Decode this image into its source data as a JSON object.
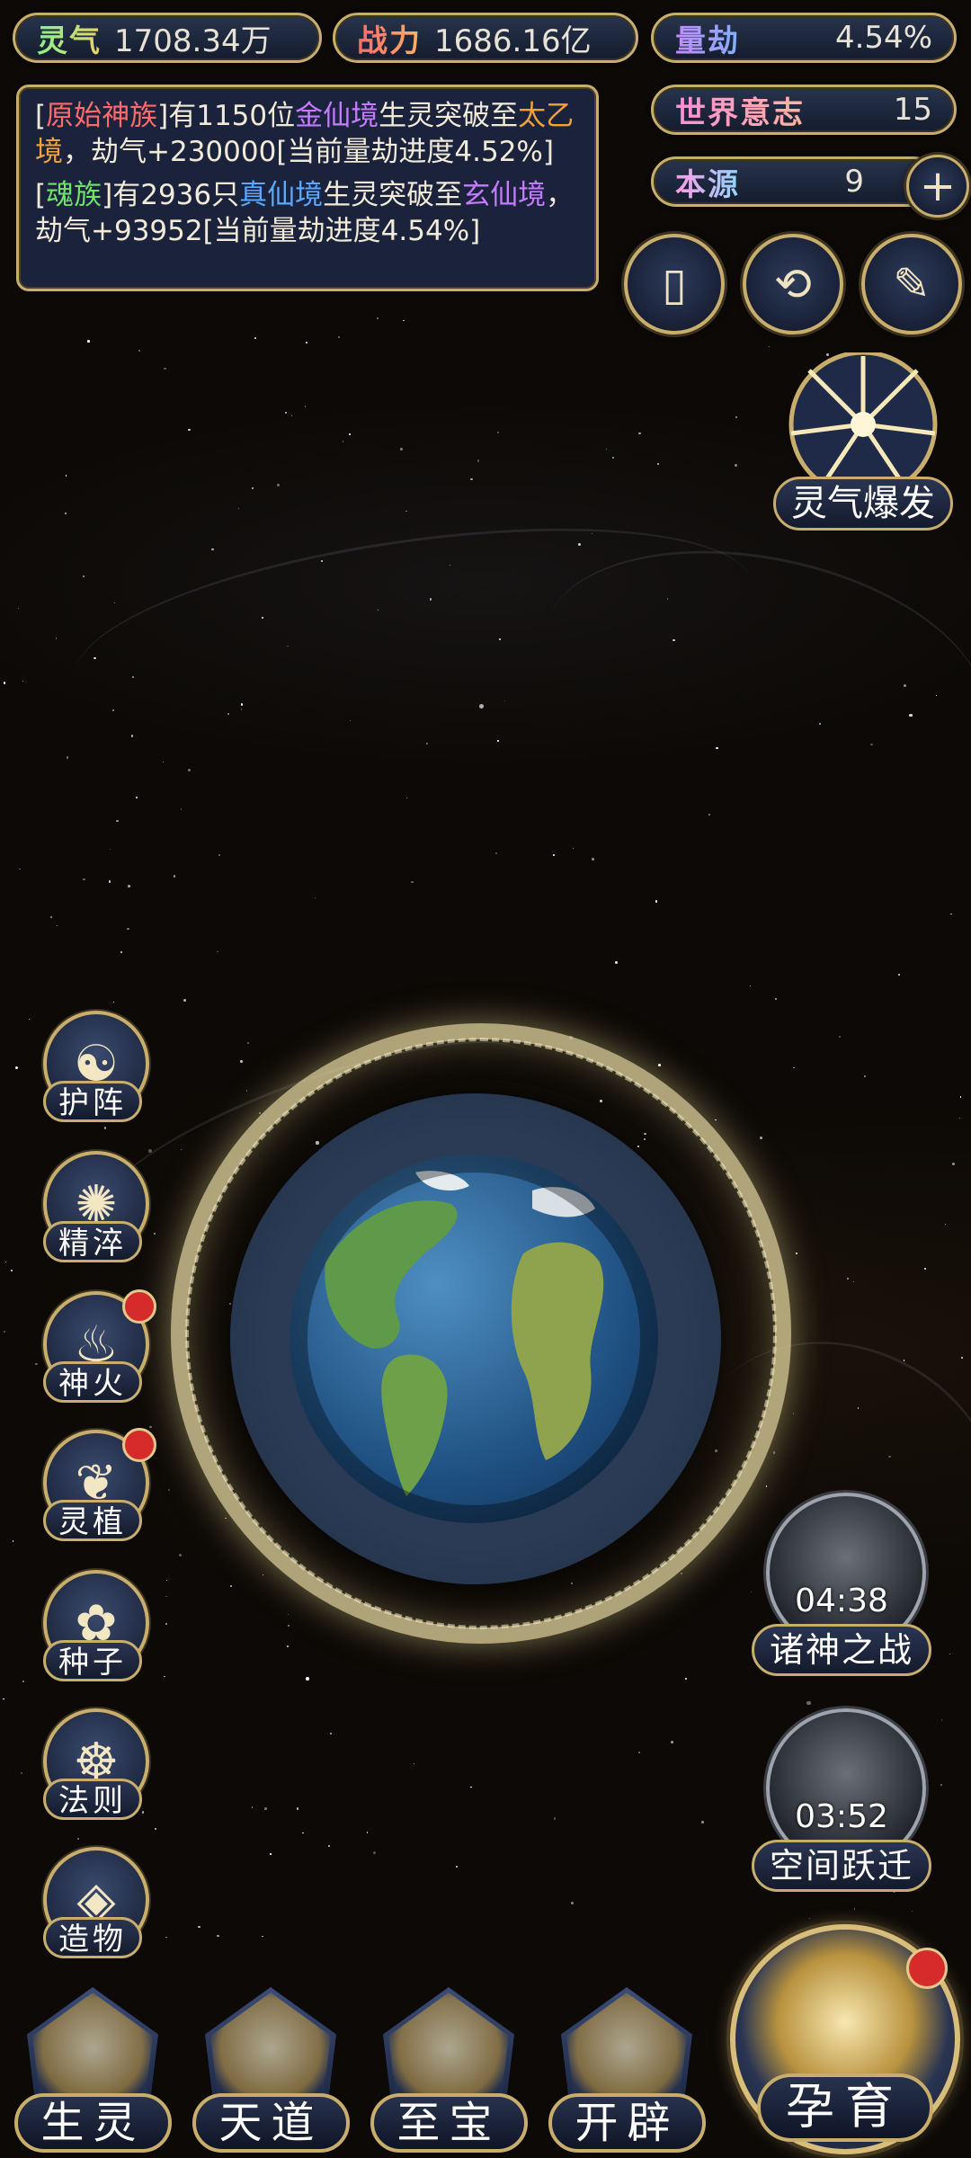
{
  "stats": {
    "lingqi": {
      "label": "灵气",
      "value": "1708.34万"
    },
    "zhanli": {
      "label": "战力",
      "value": "1686.16亿"
    },
    "liangjie": {
      "label": "量劫",
      "value": "4.54%"
    },
    "shijie_yizhi": {
      "label": "世界意志",
      "value": "15"
    },
    "benyuan": {
      "label": "本源",
      "value": "9",
      "add": "+"
    }
  },
  "log": {
    "entry1": {
      "race": "原始神族",
      "t1": "有1150位",
      "realm": "金仙境",
      "t2": "生灵突破至",
      "realm2": "太乙境",
      "t3": "，劫气+230000[当前量劫进度4.52%]"
    },
    "entry2": {
      "race": "魂族",
      "t1": "有2936只",
      "realm": "真仙境",
      "t2": "生灵突破至",
      "realm2": "玄仙境",
      "t3": "，劫气+93952[当前量劫进度4.54%]"
    }
  },
  "top_icons": {
    "card_icon": "▯",
    "vortex_icon": "⟲",
    "scroll_icon": "✎"
  },
  "burst": {
    "label": "灵气爆发"
  },
  "left_menu": [
    {
      "label": "护阵",
      "icon": "☯",
      "badge": false
    },
    {
      "label": "精淬",
      "icon": "✺",
      "badge": false
    },
    {
      "label": "神火",
      "icon": "♨",
      "badge": true
    },
    {
      "label": "灵植",
      "icon": "❦",
      "badge": true
    },
    {
      "label": "种子",
      "icon": "✿",
      "badge": false
    },
    {
      "label": "法则",
      "icon": "☸",
      "badge": false
    },
    {
      "label": "造物",
      "icon": "◈",
      "badge": false
    }
  ],
  "events": [
    {
      "label": "诸神之战",
      "timer": "04:38"
    },
    {
      "label": "空间跃迁",
      "timer": "03:52"
    }
  ],
  "bottom_nav": [
    {
      "label": "生灵"
    },
    {
      "label": "天道"
    },
    {
      "label": "至宝"
    },
    {
      "label": "开辟"
    }
  ],
  "yunyu": {
    "label": "孕育",
    "badge": true
  },
  "colors": {
    "gold": "#c9ae6b",
    "panel": "#1c2640",
    "badge": "#d62b2b"
  }
}
